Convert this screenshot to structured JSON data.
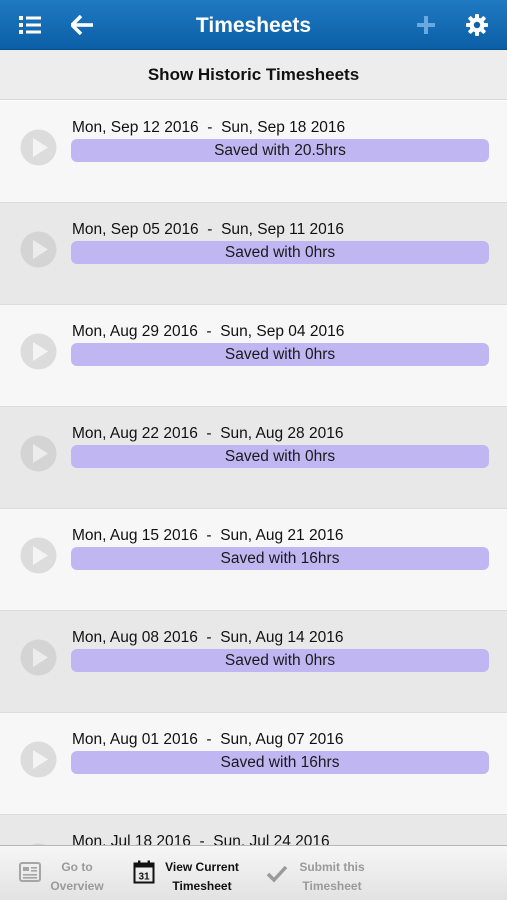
{
  "header": {
    "title": "Timesheets",
    "icons": [
      "list-icon",
      "back-arrow-icon",
      "plus-icon",
      "gear-icon"
    ]
  },
  "historic": {
    "label": "Show Historic Timesheets"
  },
  "timesheets": [
    {
      "range": "Mon, Sep 12 2016  -  Sun, Sep 18 2016",
      "status": "Saved with 20.5hrs"
    },
    {
      "range": "Mon, Sep 05 2016  -  Sun, Sep 11 2016",
      "status": "Saved with 0hrs"
    },
    {
      "range": "Mon, Aug 29 2016  -  Sun, Sep 04 2016",
      "status": "Saved with 0hrs"
    },
    {
      "range": "Mon, Aug 22 2016  -  Sun, Aug 28 2016",
      "status": "Saved with 0hrs"
    },
    {
      "range": "Mon, Aug 15 2016  -  Sun, Aug 21 2016",
      "status": "Saved with 16hrs"
    },
    {
      "range": "Mon, Aug 08 2016  -  Sun, Aug 14 2016",
      "status": "Saved with 0hrs"
    },
    {
      "range": "Mon, Aug 01 2016  -  Sun, Aug 07 2016",
      "status": "Saved with 16hrs"
    },
    {
      "range": "Mon, Jul 18 2016  -  Sun, Jul 24 2016",
      "status": ""
    }
  ],
  "tabbar": {
    "overview": {
      "line1": "Go to",
      "line2": "Overview",
      "icon": "overview-icon"
    },
    "current": {
      "line1": "View Current",
      "line2": "Timesheet",
      "icon": "calendar-icon",
      "calendar_day": "31"
    },
    "submit": {
      "line1": "Submit this",
      "line2": "Timesheet",
      "icon": "checkmark-icon"
    }
  },
  "colors": {
    "header": "#0b5fa6",
    "status_bar": "#c0b6f2",
    "row_light": "#f7f7f7",
    "row_dark": "#e8e8e8"
  }
}
